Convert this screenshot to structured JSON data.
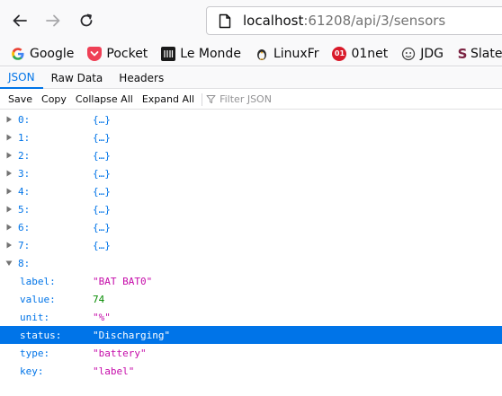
{
  "navbar": {
    "url_host": "localhost",
    "url_path": ":61208/api/3/sensors"
  },
  "bookmarks": [
    {
      "label": "Google",
      "icon": "google-icon",
      "color": "#4285f4"
    },
    {
      "label": "Pocket",
      "icon": "pocket-icon",
      "color": "#ef4056"
    },
    {
      "label": "Le Monde",
      "icon": "lemonde-icon",
      "color": "#1a1a1a"
    },
    {
      "label": "LinuxFr",
      "icon": "linuxfr-icon",
      "color": "#e8a317"
    },
    {
      "label": "01net",
      "icon": "01net-icon",
      "color": "#d91a2a"
    },
    {
      "label": "JDG",
      "icon": "jdg-icon",
      "color": "#444444"
    },
    {
      "label": "Slate.fr",
      "icon": "slate-icon",
      "color": "#7a2241"
    }
  ],
  "tabs": [
    {
      "label": "JSON",
      "active": true
    },
    {
      "label": "Raw Data",
      "active": false
    },
    {
      "label": "Headers",
      "active": false
    }
  ],
  "toolbar": {
    "save": "Save",
    "copy": "Copy",
    "collapse_all": "Collapse All",
    "expand_all": "Expand All",
    "filter_placeholder": "Filter JSON"
  },
  "tree": {
    "collapsed_items": [
      {
        "key": "0:",
        "value": "{…}"
      },
      {
        "key": "1:",
        "value": "{…}"
      },
      {
        "key": "2:",
        "value": "{…}"
      },
      {
        "key": "3:",
        "value": "{…}"
      },
      {
        "key": "4:",
        "value": "{…}"
      },
      {
        "key": "5:",
        "value": "{…}"
      },
      {
        "key": "6:",
        "value": "{…}"
      },
      {
        "key": "7:",
        "value": "{…}"
      }
    ],
    "expanded_item": {
      "key": "8:",
      "fields": [
        {
          "key": "label:",
          "value": "\"BAT BAT0\"",
          "type": "str",
          "selected": false
        },
        {
          "key": "value:",
          "value": "74",
          "type": "num",
          "selected": false
        },
        {
          "key": "unit:",
          "value": "\"%\"",
          "type": "str",
          "selected": false
        },
        {
          "key": "status:",
          "value": "\"Discharging\"",
          "type": "str",
          "selected": true
        },
        {
          "key": "type:",
          "value": "\"battery\"",
          "type": "str",
          "selected": false
        },
        {
          "key": "key:",
          "value": "\"label\"",
          "type": "str",
          "selected": false
        }
      ]
    }
  },
  "colors": {
    "accent": "#0074e8",
    "string": "#c50ba9",
    "number": "#058b00"
  }
}
